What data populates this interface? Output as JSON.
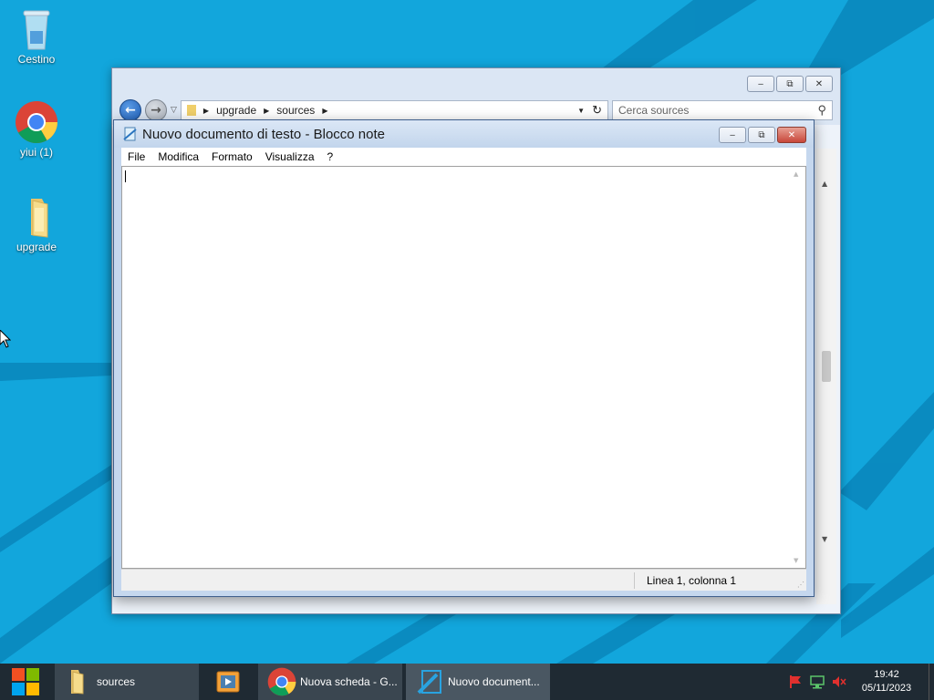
{
  "desktop": {
    "icons": [
      {
        "label": "Cestino",
        "icon": "recycle-bin-icon"
      },
      {
        "label": "yiui (1)",
        "icon": "chrome-icon"
      },
      {
        "label": "upgrade",
        "icon": "folder-icon"
      }
    ]
  },
  "explorer": {
    "breadcrumb": [
      "upgrade",
      "sources"
    ],
    "search_placeholder": "Cerca sources",
    "buttons": {
      "minimize": "minimize",
      "maximize": "maximize",
      "close": "close"
    }
  },
  "notepad": {
    "title": "Nuovo documento di testo - Blocco note",
    "menu": [
      "File",
      "Modifica",
      "Formato",
      "Visualizza",
      "?"
    ],
    "content": "",
    "status_position": "Linea 1, colonna 1"
  },
  "taskbar": {
    "items": [
      {
        "label": "sources",
        "icon": "folder-icon"
      },
      {
        "label": "",
        "icon": "media-player-icon"
      },
      {
        "label": "Nuova scheda - G...",
        "icon": "chrome-icon"
      },
      {
        "label": "Nuovo document...",
        "icon": "notepad-icon"
      }
    ],
    "clock": {
      "time": "19:42",
      "date": "05/11/2023"
    }
  },
  "colors": {
    "desktop_bg": "#12a6dc",
    "taskbar_bg": "#1f2a33",
    "close_red": "#c8473a"
  }
}
